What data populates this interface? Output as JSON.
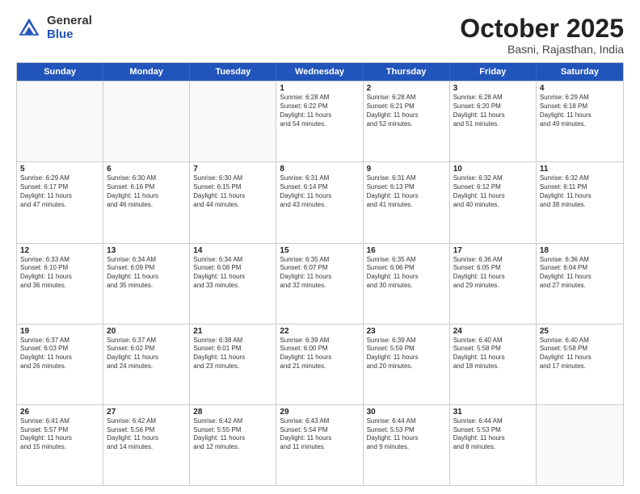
{
  "header": {
    "logo_general": "General",
    "logo_blue": "Blue",
    "month_title": "October 2025",
    "subtitle": "Basni, Rajasthan, India"
  },
  "calendar": {
    "days": [
      "Sunday",
      "Monday",
      "Tuesday",
      "Wednesday",
      "Thursday",
      "Friday",
      "Saturday"
    ],
    "rows": [
      [
        {
          "day": "",
          "info": ""
        },
        {
          "day": "",
          "info": ""
        },
        {
          "day": "",
          "info": ""
        },
        {
          "day": "1",
          "info": "Sunrise: 6:28 AM\nSunset: 6:22 PM\nDaylight: 11 hours\nand 54 minutes."
        },
        {
          "day": "2",
          "info": "Sunrise: 6:28 AM\nSunset: 6:21 PM\nDaylight: 11 hours\nand 52 minutes."
        },
        {
          "day": "3",
          "info": "Sunrise: 6:28 AM\nSunset: 6:20 PM\nDaylight: 11 hours\nand 51 minutes."
        },
        {
          "day": "4",
          "info": "Sunrise: 6:29 AM\nSunset: 6:18 PM\nDaylight: 11 hours\nand 49 minutes."
        }
      ],
      [
        {
          "day": "5",
          "info": "Sunrise: 6:29 AM\nSunset: 6:17 PM\nDaylight: 11 hours\nand 47 minutes."
        },
        {
          "day": "6",
          "info": "Sunrise: 6:30 AM\nSunset: 6:16 PM\nDaylight: 11 hours\nand 46 minutes."
        },
        {
          "day": "7",
          "info": "Sunrise: 6:30 AM\nSunset: 6:15 PM\nDaylight: 11 hours\nand 44 minutes."
        },
        {
          "day": "8",
          "info": "Sunrise: 6:31 AM\nSunset: 6:14 PM\nDaylight: 11 hours\nand 43 minutes."
        },
        {
          "day": "9",
          "info": "Sunrise: 6:31 AM\nSunset: 6:13 PM\nDaylight: 11 hours\nand 41 minutes."
        },
        {
          "day": "10",
          "info": "Sunrise: 6:32 AM\nSunset: 6:12 PM\nDaylight: 11 hours\nand 40 minutes."
        },
        {
          "day": "11",
          "info": "Sunrise: 6:32 AM\nSunset: 6:11 PM\nDaylight: 11 hours\nand 38 minutes."
        }
      ],
      [
        {
          "day": "12",
          "info": "Sunrise: 6:33 AM\nSunset: 6:10 PM\nDaylight: 11 hours\nand 36 minutes."
        },
        {
          "day": "13",
          "info": "Sunrise: 6:34 AM\nSunset: 6:09 PM\nDaylight: 11 hours\nand 35 minutes."
        },
        {
          "day": "14",
          "info": "Sunrise: 6:34 AM\nSunset: 6:08 PM\nDaylight: 11 hours\nand 33 minutes."
        },
        {
          "day": "15",
          "info": "Sunrise: 6:35 AM\nSunset: 6:07 PM\nDaylight: 11 hours\nand 32 minutes."
        },
        {
          "day": "16",
          "info": "Sunrise: 6:35 AM\nSunset: 6:06 PM\nDaylight: 11 hours\nand 30 minutes."
        },
        {
          "day": "17",
          "info": "Sunrise: 6:36 AM\nSunset: 6:05 PM\nDaylight: 11 hours\nand 29 minutes."
        },
        {
          "day": "18",
          "info": "Sunrise: 6:36 AM\nSunset: 6:04 PM\nDaylight: 11 hours\nand 27 minutes."
        }
      ],
      [
        {
          "day": "19",
          "info": "Sunrise: 6:37 AM\nSunset: 6:03 PM\nDaylight: 11 hours\nand 26 minutes."
        },
        {
          "day": "20",
          "info": "Sunrise: 6:37 AM\nSunset: 6:02 PM\nDaylight: 11 hours\nand 24 minutes."
        },
        {
          "day": "21",
          "info": "Sunrise: 6:38 AM\nSunset: 6:01 PM\nDaylight: 11 hours\nand 23 minutes."
        },
        {
          "day": "22",
          "info": "Sunrise: 6:39 AM\nSunset: 6:00 PM\nDaylight: 11 hours\nand 21 minutes."
        },
        {
          "day": "23",
          "info": "Sunrise: 6:39 AM\nSunset: 5:59 PM\nDaylight: 11 hours\nand 20 minutes."
        },
        {
          "day": "24",
          "info": "Sunrise: 6:40 AM\nSunset: 5:58 PM\nDaylight: 11 hours\nand 18 minutes."
        },
        {
          "day": "25",
          "info": "Sunrise: 6:40 AM\nSunset: 5:58 PM\nDaylight: 11 hours\nand 17 minutes."
        }
      ],
      [
        {
          "day": "26",
          "info": "Sunrise: 6:41 AM\nSunset: 5:57 PM\nDaylight: 11 hours\nand 15 minutes."
        },
        {
          "day": "27",
          "info": "Sunrise: 6:42 AM\nSunset: 5:56 PM\nDaylight: 11 hours\nand 14 minutes."
        },
        {
          "day": "28",
          "info": "Sunrise: 6:42 AM\nSunset: 5:55 PM\nDaylight: 11 hours\nand 12 minutes."
        },
        {
          "day": "29",
          "info": "Sunrise: 6:43 AM\nSunset: 5:54 PM\nDaylight: 11 hours\nand 11 minutes."
        },
        {
          "day": "30",
          "info": "Sunrise: 6:44 AM\nSunset: 5:53 PM\nDaylight: 11 hours\nand 9 minutes."
        },
        {
          "day": "31",
          "info": "Sunrise: 6:44 AM\nSunset: 5:53 PM\nDaylight: 11 hours\nand 8 minutes."
        },
        {
          "day": "",
          "info": ""
        }
      ]
    ]
  }
}
